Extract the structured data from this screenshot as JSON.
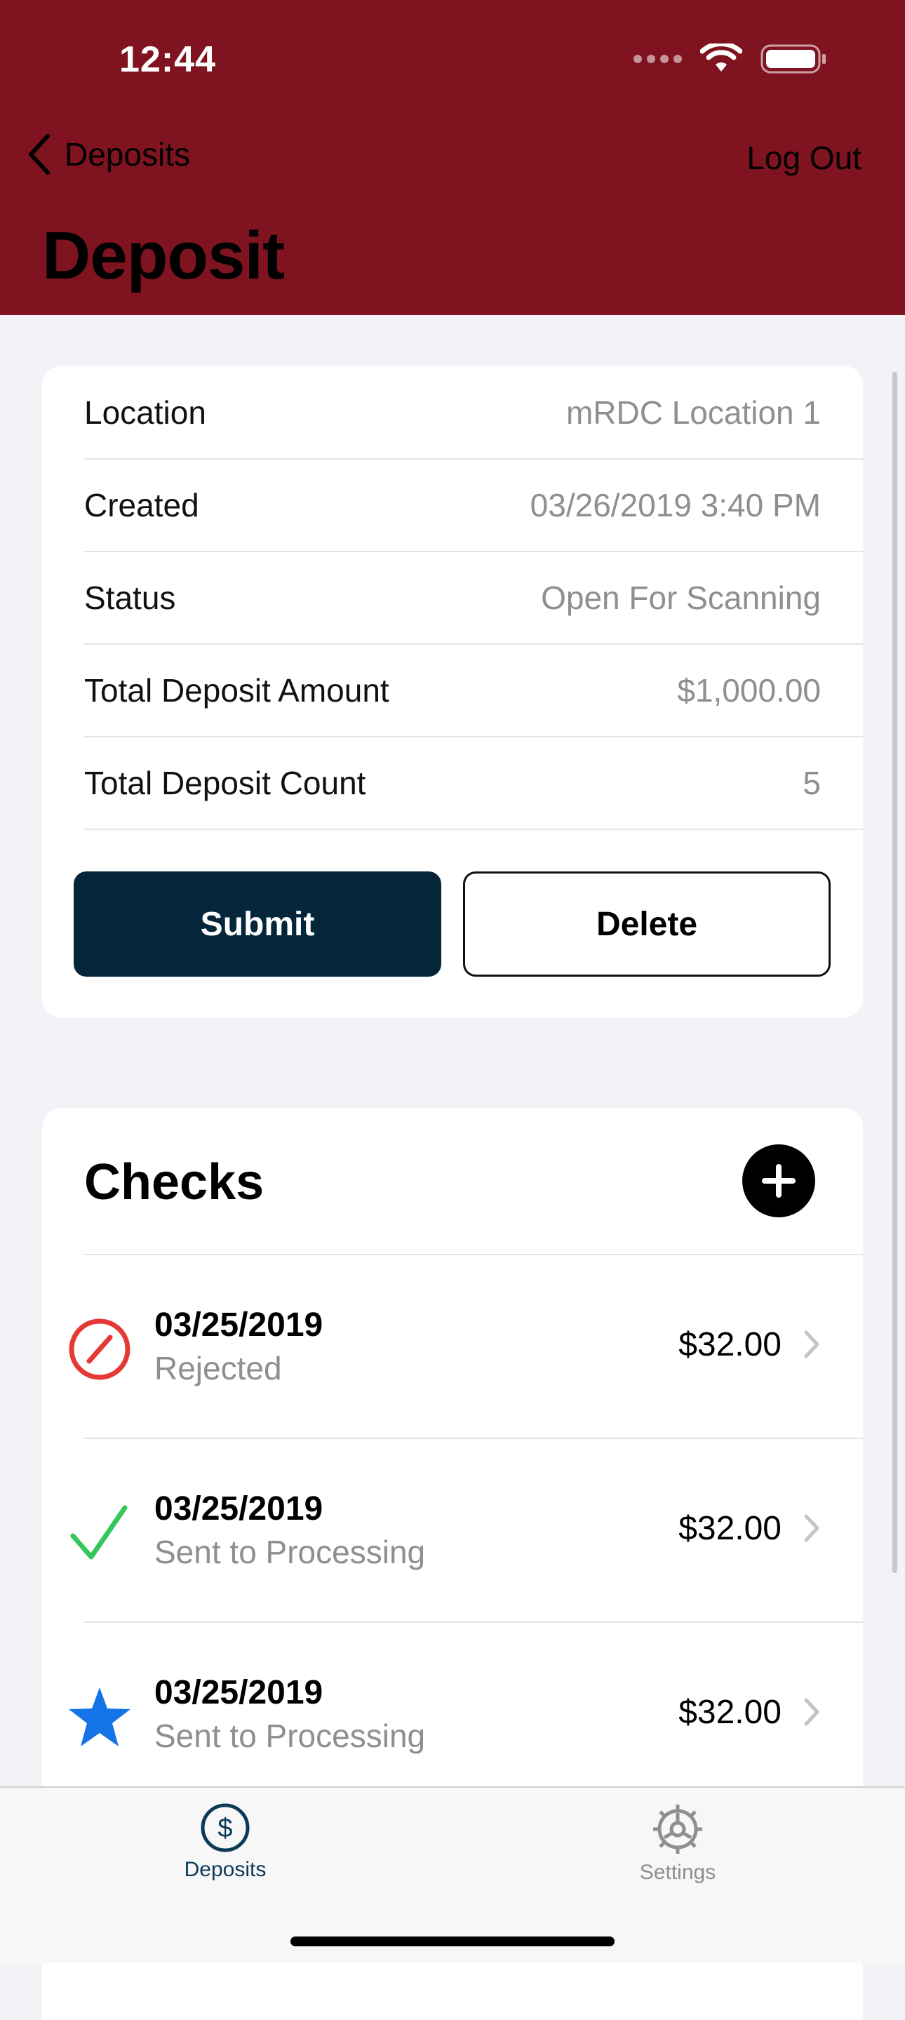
{
  "status_bar": {
    "time": "12:44"
  },
  "nav": {
    "back_label": "Deposits",
    "right_label": "Log Out",
    "title": "Deposit"
  },
  "details": {
    "rows": [
      {
        "label": "Location",
        "value": "mRDC Location 1"
      },
      {
        "label": "Created",
        "value": "03/26/2019 3:40 PM"
      },
      {
        "label": "Status",
        "value": "Open For Scanning"
      },
      {
        "label": "Total Deposit Amount",
        "value": "$1,000.00"
      },
      {
        "label": "Total Deposit Count",
        "value": "5"
      }
    ],
    "submit_label": "Submit",
    "delete_label": "Delete"
  },
  "checks": {
    "title": "Checks",
    "items": [
      {
        "date": "03/25/2019",
        "status": "Rejected",
        "amount": "$32.00",
        "icon": "rejected-icon"
      },
      {
        "date": "03/25/2019",
        "status": "Sent to Processing",
        "amount": "$32.00",
        "icon": "checkmark-icon"
      },
      {
        "date": "03/25/2019",
        "status": "Sent to Processing",
        "amount": "$32.00",
        "icon": "star-icon"
      }
    ]
  },
  "tabbar": {
    "tabs": [
      {
        "label": "Deposits",
        "icon": "dollar-circle-icon",
        "active": true
      },
      {
        "label": "Settings",
        "icon": "gear-icon",
        "active": false
      }
    ]
  },
  "colors": {
    "header": "#7f131f",
    "primary_button": "#04253a",
    "rejected": "#e53935",
    "approved": "#34c759",
    "star": "#1473e6",
    "tab_active": "#0b3a57"
  }
}
